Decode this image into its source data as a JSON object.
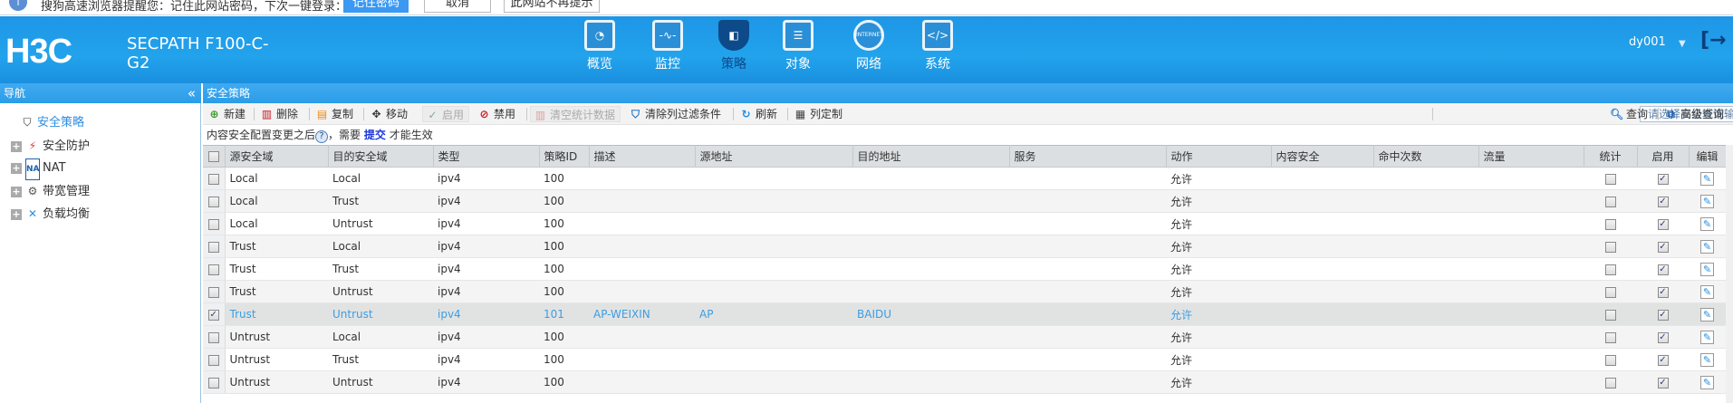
{
  "banner": {
    "icon": "info-icon",
    "message": "搜狗高速浏览器提醒您：记住此网站密码，下次一键登录：",
    "remember": "记住密码",
    "cancel": "取消",
    "never": "此网站不再提示"
  },
  "header": {
    "logo": "H3C",
    "product": "SECPATH F100-C-G2",
    "user": "dy001",
    "nav": [
      {
        "label": "概览",
        "icon": "gauge-icon"
      },
      {
        "label": "监控",
        "icon": "monitor-icon"
      },
      {
        "label": "策略",
        "icon": "shield-icon",
        "active": true
      },
      {
        "label": "对象",
        "icon": "server-icon"
      },
      {
        "label": "网络",
        "icon": "internet-icon"
      },
      {
        "label": "系统",
        "icon": "code-window-icon"
      }
    ]
  },
  "navbar": {
    "title": "导航",
    "collapse": "«"
  },
  "main": {
    "title": "安全策略"
  },
  "sidebar": {
    "items": [
      {
        "label": "安全策略",
        "active": true
      },
      {
        "label": "安全防护"
      },
      {
        "label": "NAT"
      },
      {
        "label": "带宽管理"
      },
      {
        "label": "负载均衡"
      }
    ]
  },
  "toolbar": {
    "new": "新建",
    "delete": "删除",
    "copy": "复制",
    "move": "移动",
    "enable": "启用",
    "disable": "禁用",
    "clear_stats": "清空统计数据",
    "clear_filter": "清除列过滤条件",
    "refresh": "刷新",
    "columns": "列定制",
    "search_placeholder": "请选择安全域或输入查询内容",
    "query": "查询",
    "advanced_query": "高级查询"
  },
  "notice": {
    "before": "内容安全配置变更之后",
    "mid": "，需要",
    "link": "提交",
    "after": "才能生效"
  },
  "colors": {
    "header": "#22a3ec",
    "zone_link": "#2a1ad8",
    "selected_text": "#3d9de2",
    "selected_row": "#e1e3e3"
  },
  "table": {
    "columns": [
      "源安全域",
      "目的安全域",
      "类型",
      "策略ID",
      "描述",
      "源地址",
      "目的地址",
      "服务",
      "动作",
      "内容安全",
      "命中次数",
      "流量",
      "统计",
      "启用",
      "编辑"
    ],
    "rows": [
      {
        "src": "Local",
        "dst": "Local",
        "type": "ipv4",
        "id": "100",
        "desc": "",
        "saddr": "",
        "daddr": "",
        "svc": "",
        "action": "允许",
        "stats": false,
        "enabled": true,
        "selected": false
      },
      {
        "src": "Local",
        "dst": "Trust",
        "type": "ipv4",
        "id": "100",
        "desc": "",
        "saddr": "",
        "daddr": "",
        "svc": "",
        "action": "允许",
        "stats": false,
        "enabled": true,
        "selected": false
      },
      {
        "src": "Local",
        "dst": "Untrust",
        "type": "ipv4",
        "id": "100",
        "desc": "",
        "saddr": "",
        "daddr": "",
        "svc": "",
        "action": "允许",
        "stats": false,
        "enabled": true,
        "selected": false
      },
      {
        "src": "Trust",
        "dst": "Local",
        "type": "ipv4",
        "id": "100",
        "desc": "",
        "saddr": "",
        "daddr": "",
        "svc": "",
        "action": "允许",
        "stats": false,
        "enabled": true,
        "selected": false
      },
      {
        "src": "Trust",
        "dst": "Trust",
        "type": "ipv4",
        "id": "100",
        "desc": "",
        "saddr": "",
        "daddr": "",
        "svc": "",
        "action": "允许",
        "stats": false,
        "enabled": true,
        "selected": false
      },
      {
        "src": "Trust",
        "dst": "Untrust",
        "type": "ipv4",
        "id": "100",
        "desc": "",
        "saddr": "",
        "daddr": "",
        "svc": "",
        "action": "允许",
        "stats": false,
        "enabled": true,
        "selected": false
      },
      {
        "src": "Trust",
        "dst": "Untrust",
        "type": "ipv4",
        "id": "101",
        "desc": "AP-WEIXIN",
        "saddr": "AP",
        "daddr": "BAIDU",
        "svc": "",
        "action": "允许",
        "stats": false,
        "enabled": true,
        "selected": true
      },
      {
        "src": "Untrust",
        "dst": "Local",
        "type": "ipv4",
        "id": "100",
        "desc": "",
        "saddr": "",
        "daddr": "",
        "svc": "",
        "action": "允许",
        "stats": false,
        "enabled": true,
        "selected": false
      },
      {
        "src": "Untrust",
        "dst": "Trust",
        "type": "ipv4",
        "id": "100",
        "desc": "",
        "saddr": "",
        "daddr": "",
        "svc": "",
        "action": "允许",
        "stats": false,
        "enabled": true,
        "selected": false
      },
      {
        "src": "Untrust",
        "dst": "Untrust",
        "type": "ipv4",
        "id": "100",
        "desc": "",
        "saddr": "",
        "daddr": "",
        "svc": "",
        "action": "允许",
        "stats": false,
        "enabled": true,
        "selected": false
      }
    ]
  }
}
